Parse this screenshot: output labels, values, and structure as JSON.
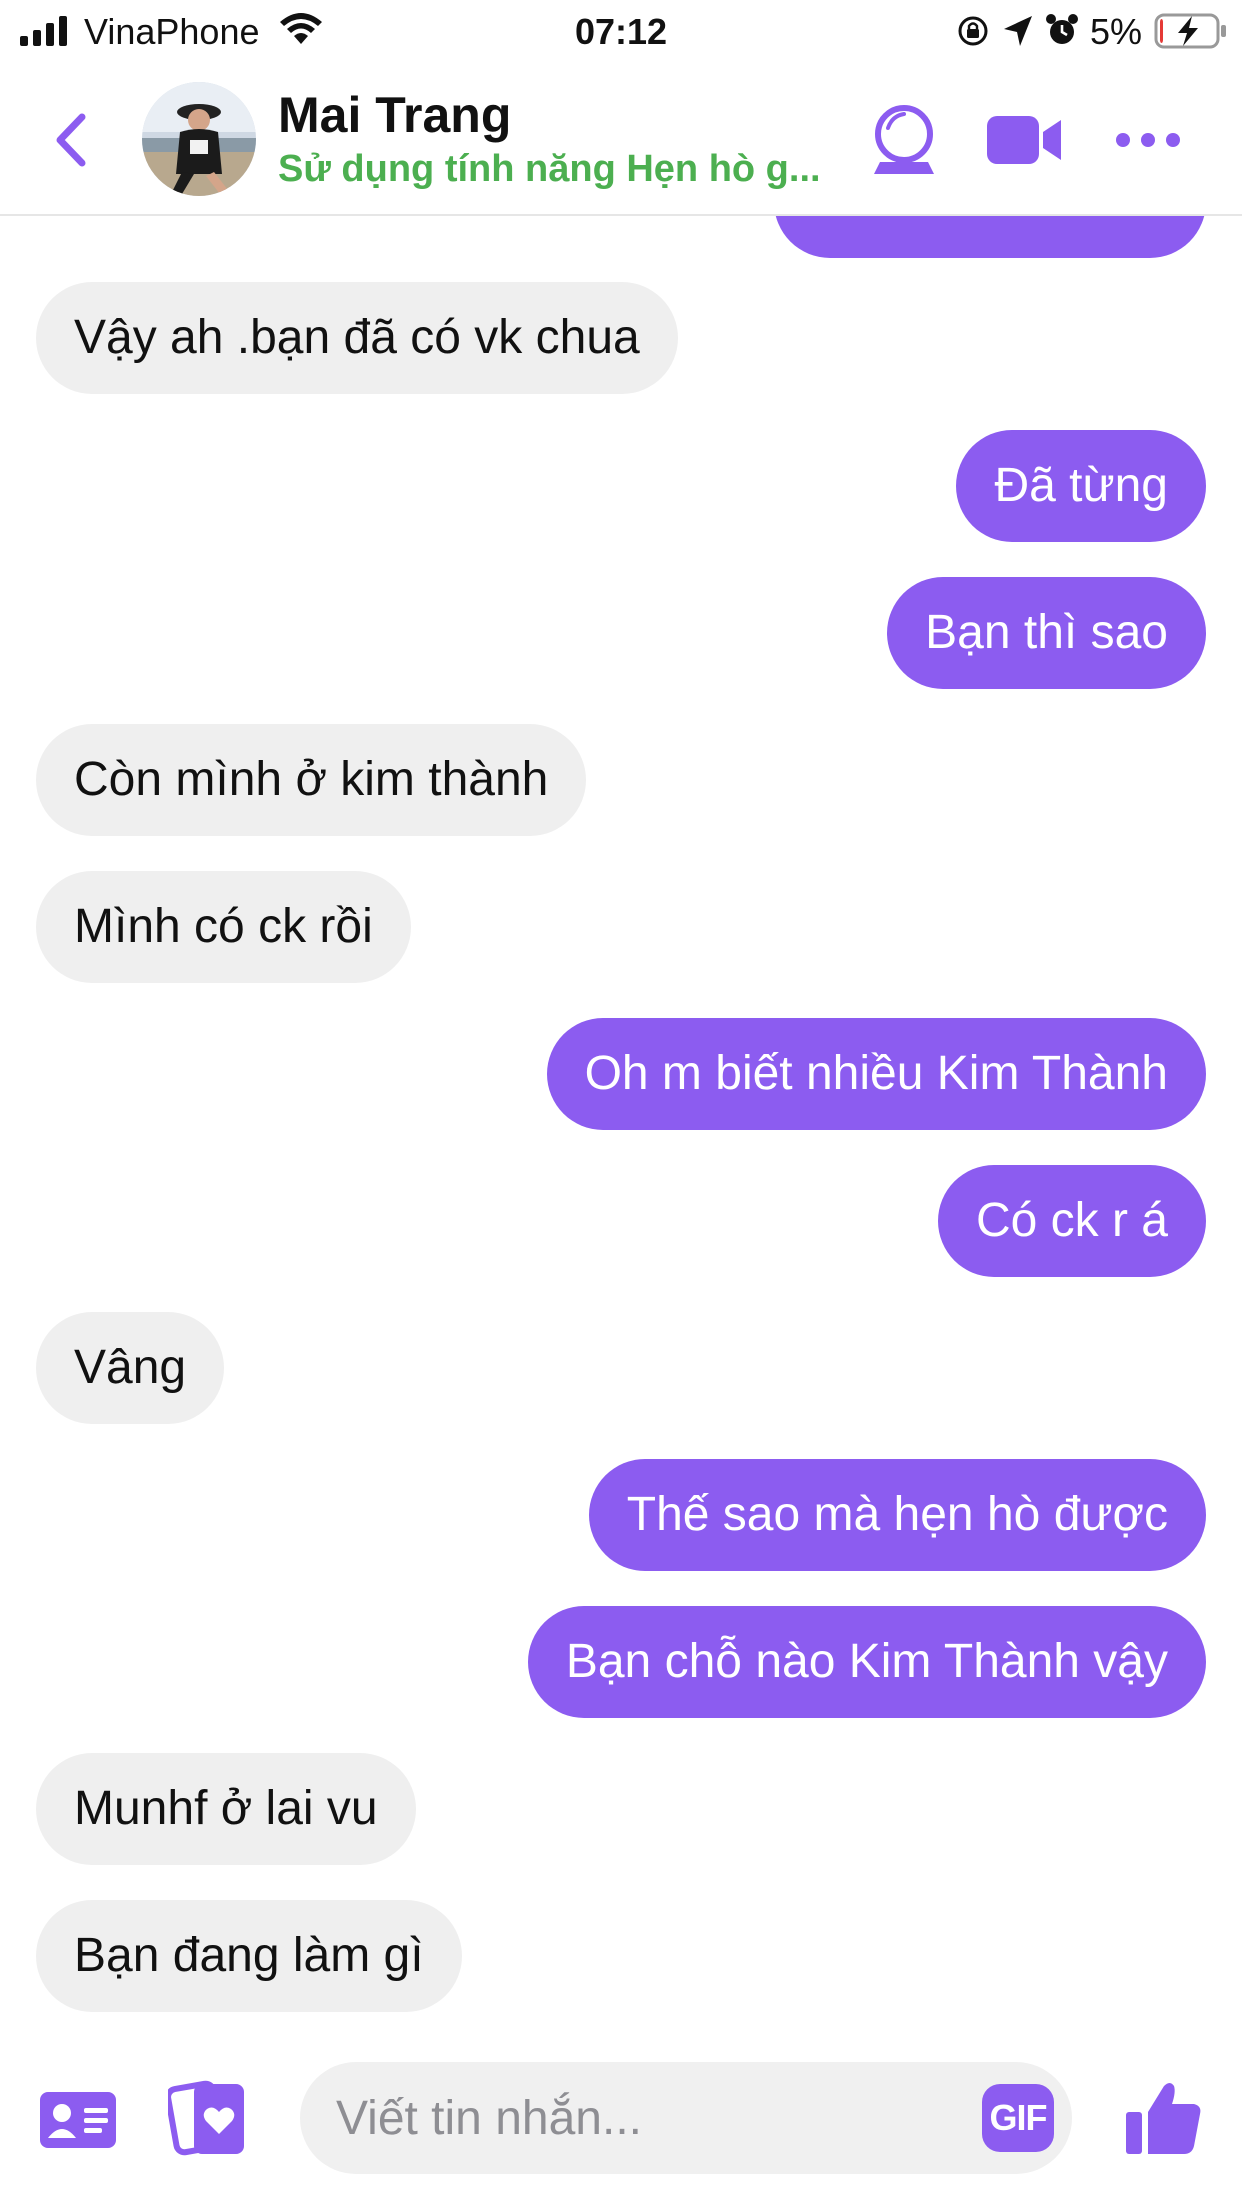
{
  "status_bar": {
    "carrier": "VinaPhone",
    "time": "07:12",
    "battery_percent": "5%",
    "battery_level": 0.05,
    "icons": [
      "signal-icon",
      "wifi-icon",
      "rotation-lock-icon",
      "location-icon",
      "alarm-icon",
      "battery-charging-icon"
    ]
  },
  "header": {
    "name": "Mai Trang",
    "status": "Sử dụng tính năng Hẹn hò g...",
    "status_color": "#4caf50",
    "icons": [
      "back-icon",
      "crystal-ball-icon",
      "video-call-icon",
      "more-icon"
    ]
  },
  "theme": {
    "accent": "#8c5cf0",
    "incoming_bg": "#efefef",
    "outgoing_text": "#ffffff"
  },
  "messages": [
    {
      "dir": "out",
      "text": ""
    },
    {
      "dir": "in",
      "text": "Vậy ah .bạn đã có vk chua"
    },
    {
      "dir": "out",
      "text": "Đã từng"
    },
    {
      "dir": "out",
      "text": "Bạn thì sao"
    },
    {
      "dir": "in",
      "text": "Còn mình ở kim thành"
    },
    {
      "dir": "in",
      "text": "Mình có ck rồi"
    },
    {
      "dir": "out",
      "text": "Oh m biết nhiều Kim Thành"
    },
    {
      "dir": "out",
      "text": "Có ck r á"
    },
    {
      "dir": "in",
      "text": "Vâng"
    },
    {
      "dir": "out",
      "text": "Thế sao mà hẹn hò được"
    },
    {
      "dir": "out",
      "text": "Bạn chỗ nào Kim Thành vậy"
    },
    {
      "dir": "in",
      "text": "Munhf ở lai vu"
    },
    {
      "dir": "in",
      "text": "Bạn đang làm gì"
    }
  ],
  "composer": {
    "placeholder": "Viết tin nhắn...",
    "gif_label": "GIF",
    "icons": [
      "contact-card-icon",
      "dating-cards-icon",
      "like-icon"
    ]
  }
}
